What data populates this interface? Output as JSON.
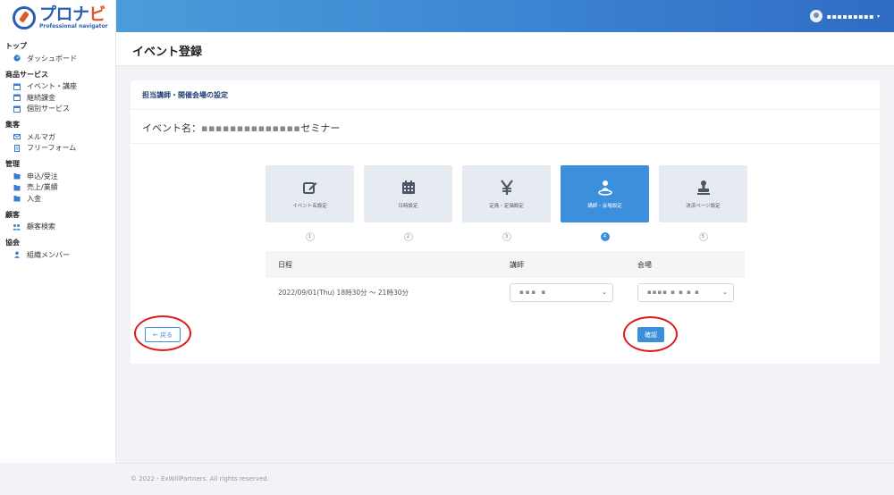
{
  "brand": {
    "logo_main": "プロナ",
    "logo_accent": "ビ",
    "logo_sub": "Professional navigator"
  },
  "header": {
    "user_name": "▪▪▪▪▪▪▪▪▪",
    "caret": "▾"
  },
  "sidebar": {
    "groups": [
      {
        "title": "トップ",
        "items": [
          {
            "label": "ダッシュボード",
            "icon": "dashboard-icon"
          }
        ]
      },
      {
        "title": "商品サービス",
        "items": [
          {
            "label": "イベント・講座",
            "icon": "calendar-icon"
          },
          {
            "label": "継続課金",
            "icon": "calendar-icon"
          },
          {
            "label": "個別サービス",
            "icon": "calendar-icon"
          }
        ]
      },
      {
        "title": "集客",
        "items": [
          {
            "label": "メルマガ",
            "icon": "mail-icon"
          },
          {
            "label": "フリーフォーム",
            "icon": "document-icon"
          }
        ]
      },
      {
        "title": "管理",
        "items": [
          {
            "label": "申込/受注",
            "icon": "folder-icon"
          },
          {
            "label": "売上/業績",
            "icon": "folder-icon"
          },
          {
            "label": "入金",
            "icon": "folder-icon"
          }
        ]
      },
      {
        "title": "顧客",
        "items": [
          {
            "label": "顧客検索",
            "icon": "users-icon"
          }
        ]
      },
      {
        "title": "協会",
        "items": [
          {
            "label": "組織メンバー",
            "icon": "user-icon"
          }
        ]
      }
    ]
  },
  "page": {
    "title": "イベント登録"
  },
  "card": {
    "heading": "担当講師・開催会場の設定",
    "event_label": "イベント名：",
    "event_name_blurred": "▪▪▪▪▪▪▪▪▪▪▪▪▪▪",
    "event_name_suffix": "セミナー"
  },
  "steps": [
    {
      "label": "イベント名設定",
      "num": "1",
      "icon": "edit-icon",
      "active": false
    },
    {
      "label": "日時設定",
      "num": "2",
      "icon": "calendar-grid-icon",
      "active": false
    },
    {
      "label": "定員・定価設定",
      "num": "3",
      "icon": "yen-icon",
      "active": false
    },
    {
      "label": "講師・会場設定",
      "num": "4",
      "icon": "location-user-icon",
      "active": true
    },
    {
      "label": "決済ページ設定",
      "num": "5",
      "icon": "stamp-icon",
      "active": false
    }
  ],
  "table": {
    "headers": {
      "date": "日程",
      "instructor": "講師",
      "venue": "会場"
    },
    "rows": [
      {
        "date": "2022/09/01(Thu) 18時30分 ～ 21時30分",
        "instructor": "▪▪▪ ▪",
        "venue": "▪▪▪▪ ▪ ▪ ▪ ▪"
      }
    ]
  },
  "buttons": {
    "back": "← 戻る",
    "confirm": "確認"
  },
  "footer": {
    "copyright": "© 2022 - ExWillPartners. All rights reserved."
  }
}
